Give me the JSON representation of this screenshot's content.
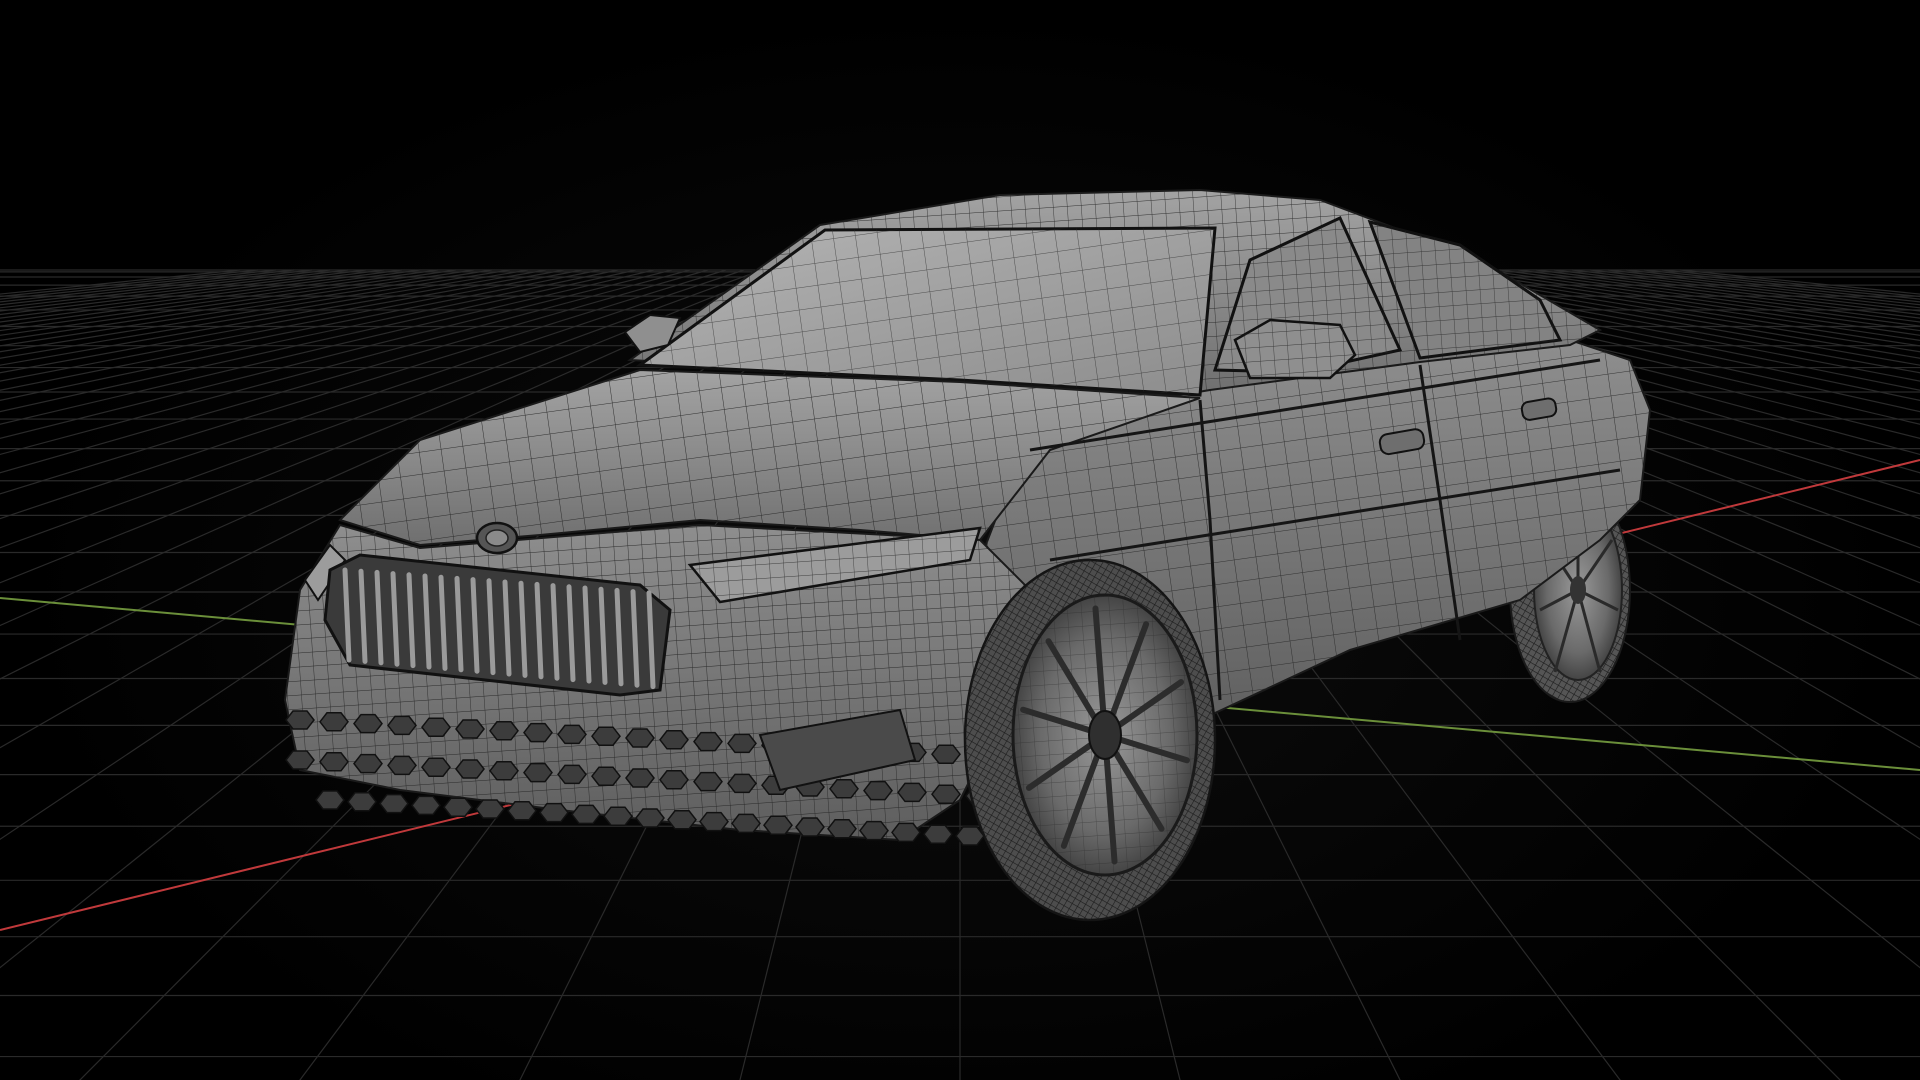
{
  "viewport": {
    "background_color": "#000000",
    "grid_color": "#2a2a2a",
    "x_axis_color": "#c0393b",
    "y_axis_color": "#6b8f3a",
    "model_fill_color": "#8c8c8c",
    "wire_color": "#1f1f1f"
  },
  "scene": {
    "object_label": "",
    "display_mode": "wireframe-on-shaded"
  },
  "icons": {
    "car_model": "car-model-icon",
    "ground_grid": "ground-grid-icon"
  }
}
